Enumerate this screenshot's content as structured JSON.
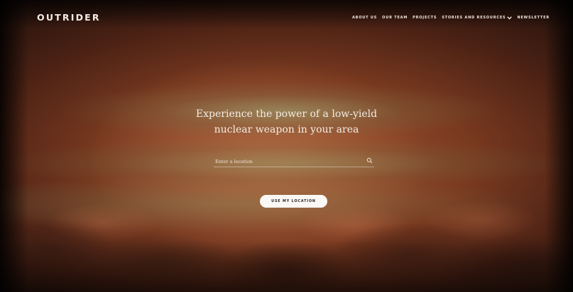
{
  "brand": {
    "logo_text": "OUTRIDER"
  },
  "nav": {
    "items": [
      {
        "label": "ABOUT US"
      },
      {
        "label": "OUR TEAM"
      },
      {
        "label": "PROJECTS"
      },
      {
        "label": "STORIES AND RESOURCES",
        "icon": "chevron-down-icon"
      },
      {
        "label": "NEWSLETTER"
      }
    ]
  },
  "hero": {
    "headline": "Experience the power of a low-yield nuclear weapon in your area"
  },
  "search": {
    "placeholder": "Enter a location",
    "value": "",
    "icon": "search-icon"
  },
  "actions": {
    "use_location_label": "USE MY LOCATION"
  },
  "colors": {
    "sky_accent": "#a4562f",
    "text_light": "#f4ece4",
    "button_bg": "#faf7f4",
    "button_text": "#2a2220"
  }
}
